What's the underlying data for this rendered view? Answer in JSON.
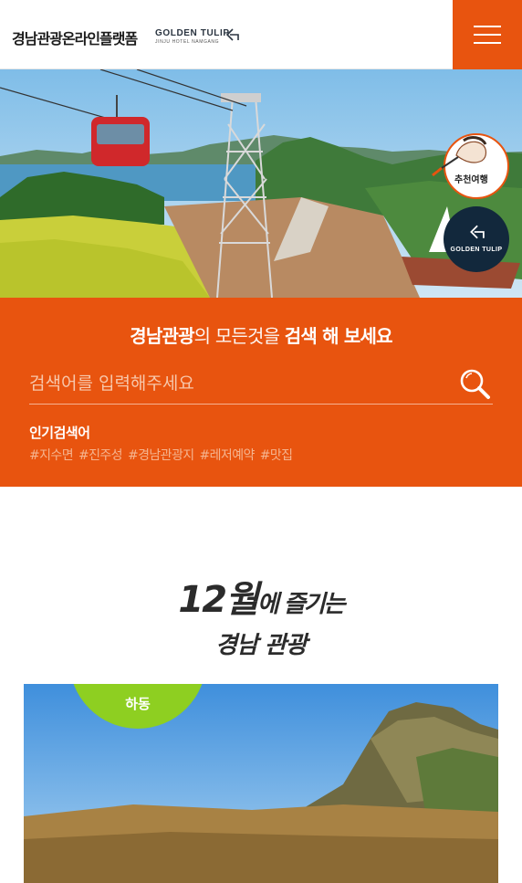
{
  "header": {
    "logo_text": "경남관광온라인플랫폼",
    "partner_name": "GOLDEN TULIP",
    "partner_location": "JINJU HOTEL NAMGANG",
    "menu_icon": "hamburger-menu-icon"
  },
  "hero": {
    "badge_recommend_label": "추천여행",
    "badge_partner_label": "GOLDEN TULIP"
  },
  "search": {
    "title_strong_1": "경남관광",
    "title_mid_1": "의 모든것을 ",
    "title_strong_2": "검색 해 보세요",
    "placeholder": "검색어를 입력해주세요",
    "search_icon": "search-icon",
    "popular_label": "인기검색어",
    "popular_tags": [
      "#지수면",
      "#진주성",
      "#경남관광지",
      "#레저예약",
      "#맛집"
    ]
  },
  "section": {
    "title_big": "12월",
    "title_rest": "에 즐기는",
    "title_line2": "경남 관광"
  },
  "card": {
    "region_tag": "하동"
  },
  "colors": {
    "accent": "#e8540f",
    "tag_green": "#8ecf21",
    "navy": "#12283c"
  }
}
